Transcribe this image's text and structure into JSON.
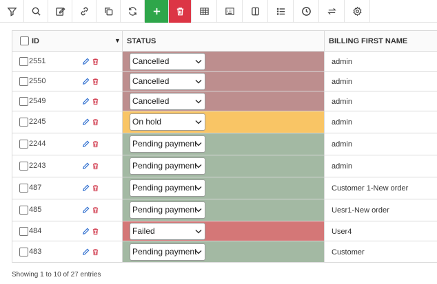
{
  "colors": {
    "cancelled": "#bd8e8e",
    "on_hold": "#f9c565",
    "pending": "#a3b9a3",
    "failed": "#d47777",
    "add": "#2ea64a",
    "delete": "#dc3545",
    "edit": "#2f6fd0"
  },
  "toolbar": {
    "buttons": [
      {
        "icon": "filter-icon"
      },
      {
        "icon": "search-icon"
      },
      {
        "icon": "edit-icon"
      },
      {
        "icon": "link-icon"
      },
      {
        "icon": "copy-icon"
      },
      {
        "icon": "refresh-icon"
      },
      {
        "icon": "plus-icon"
      },
      {
        "icon": "trash-icon"
      },
      {
        "icon": "table-icon"
      },
      {
        "icon": "keyboard-icon"
      },
      {
        "icon": "columns-icon"
      },
      {
        "icon": "list-icon"
      },
      {
        "icon": "clock-icon"
      },
      {
        "icon": "swap-icon"
      },
      {
        "icon": "gear-icon"
      }
    ]
  },
  "table": {
    "headers": {
      "id": "ID",
      "status": "STATUS",
      "billing_first_name": "BILLING FIRST NAME"
    },
    "rows": [
      {
        "id": "2551",
        "status": "Cancelled",
        "billing_first_name": "admin"
      },
      {
        "id": "2550",
        "status": "Cancelled",
        "billing_first_name": "admin"
      },
      {
        "id": "2549",
        "status": "Cancelled",
        "billing_first_name": "admin"
      },
      {
        "id": "2245",
        "status": "On hold",
        "billing_first_name": "admin"
      },
      {
        "id": "2244",
        "status": "Pending payment",
        "billing_first_name": "admin"
      },
      {
        "id": "2243",
        "status": "Pending payment",
        "billing_first_name": "admin"
      },
      {
        "id": "487",
        "status": "Pending payment",
        "billing_first_name": "Customer 1-New order"
      },
      {
        "id": "485",
        "status": "Pending payment",
        "billing_first_name": "Uesr1-New order"
      },
      {
        "id": "484",
        "status": "Failed",
        "billing_first_name": "User4"
      },
      {
        "id": "483",
        "status": "Pending payment",
        "billing_first_name": "Customer"
      }
    ]
  },
  "footer": {
    "info": "Showing 1 to 10 of 27 entries"
  }
}
